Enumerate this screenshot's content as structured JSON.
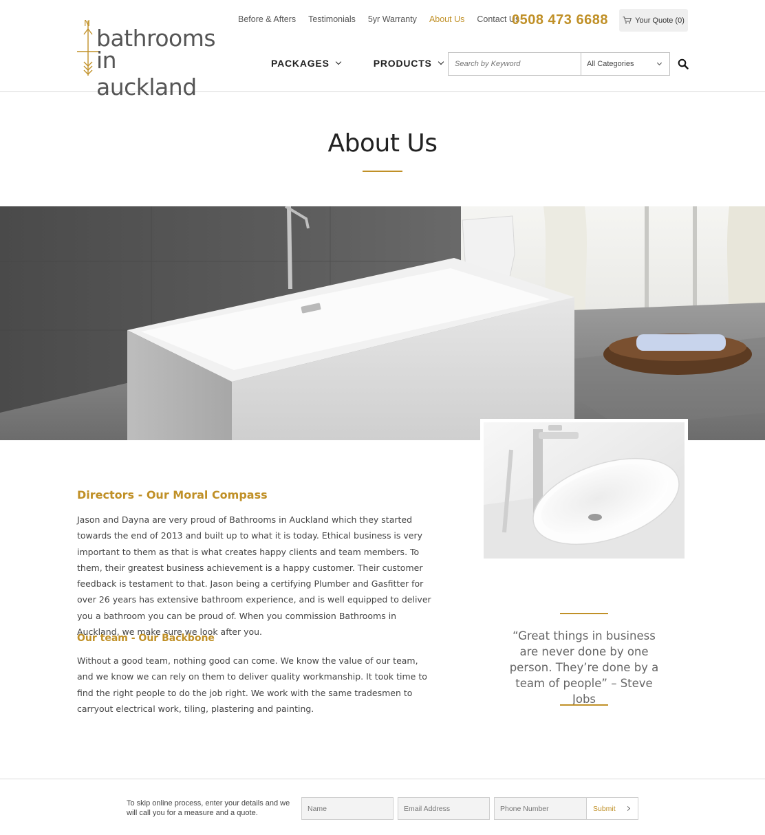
{
  "brand": {
    "line1": "bathrooms",
    "line2": "in auckland",
    "accent": "#c09027"
  },
  "topnav": {
    "items": [
      {
        "label": "Before & Afters",
        "active": false
      },
      {
        "label": "Testimonials",
        "active": false
      },
      {
        "label": "5yr Warranty",
        "active": false
      },
      {
        "label": "About Us",
        "active": true
      },
      {
        "label": "Contact Us",
        "active": false
      }
    ],
    "phone": "0508 473 6688",
    "quote_label": "Your Quote (0)",
    "quote_icon": "cart-icon"
  },
  "mainnav": {
    "items": [
      {
        "label": "PACKAGES"
      },
      {
        "label": "PRODUCTS"
      }
    ]
  },
  "search": {
    "placeholder": "Search by Keyword",
    "category": "All Categories",
    "icon": "search-icon"
  },
  "page": {
    "title": "About Us"
  },
  "content": {
    "section1_heading": "Directors - Our Moral Compass",
    "section1_body": "Jason and Dayna are very proud of Bathrooms in Auckland which they started towards the end of 2013 and built up to what it is today. Ethical business is very important to them as that is what creates happy clients and team members. To them, their greatest business achievement is a happy customer. Their customer feedback is testament to that. Jason being a certifying Plumber and Gasfitter for over 26 years has extensive bathroom experience, and is well equipped to deliver you a bathroom you can be proud of. When you commission Bathrooms in Auckland, we make sure we look after you.",
    "section2_heading": "Our team - Our Backbone",
    "section2_body": "Without a good team, nothing good can come. We know the value of our team, and we know we can rely on them to deliver quality workmanship. It took time to find the right people to do the job right. We work with the same tradesmen to carryout electrical work, tiling, plastering and painting.",
    "quote": "“Great things in business are never done by one person. They’re done by a team of people” – Steve Jobs"
  },
  "footer": {
    "text": "To skip online process, enter your details and we will call you for a measure and a quote.",
    "name_placeholder": "Name",
    "email_placeholder": "Email Address",
    "phone_placeholder": "Phone Number",
    "submit_label": "Submit"
  }
}
